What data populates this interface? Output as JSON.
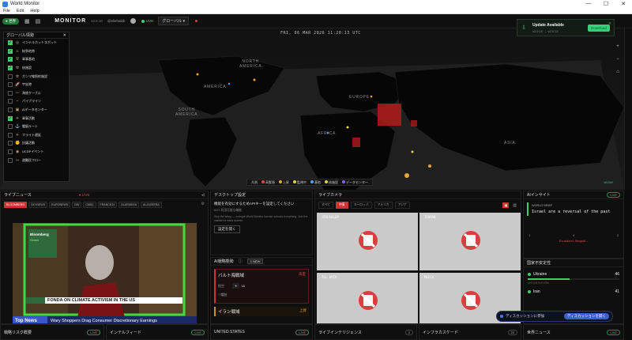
{
  "window": {
    "title": "World Monitor",
    "controls": [
      "—",
      "☐",
      "✕"
    ]
  },
  "menu": [
    "File",
    "Edit",
    "Help"
  ],
  "header": {
    "mode_badge": "● 世界",
    "brand": "MONITOR",
    "version": "v2.5.10",
    "handle": "@eliehabib",
    "live": "LIVE",
    "region": "グローバル ▾"
  },
  "update_toast": {
    "title": "Update Available",
    "subtitle": "v2.5.10 → v2.5.13",
    "button": "Download",
    "close": "✕"
  },
  "map": {
    "date": "FRI, 06 MAR 2026 11:20:13 UTC",
    "labels": {
      "north_america": "NORTH\nAMERICA",
      "america": "AMERICA",
      "south_america": "SOUTH\nAMERICA",
      "europe": "EUROPE",
      "africa": "AFRICA",
      "asia": "ASIA"
    },
    "layers_title": "グローバル情勢",
    "layers_close": "✕",
    "layers": [
      {
        "label": "インテルホットスポット",
        "on": true
      },
      {
        "label": "紛争地帯",
        "on": true
      },
      {
        "label": "軍事基地",
        "on": true
      },
      {
        "label": "核施設",
        "on": true
      },
      {
        "label": "ガンマ線照射施設",
        "on": false
      },
      {
        "label": "宇宙港",
        "on": false
      },
      {
        "label": "海底ケーブル",
        "on": false
      },
      {
        "label": "パイプライン",
        "on": false
      },
      {
        "label": "AIデータセンター",
        "on": false
      },
      {
        "label": "軍事活動",
        "on": true
      },
      {
        "label": "艦艇ルート",
        "on": false
      },
      {
        "label": "フライト遅延",
        "on": false
      },
      {
        "label": "抗議活動",
        "on": false
      },
      {
        "label": "UCDPイベント",
        "on": false
      },
      {
        "label": "避難民フロー",
        "on": false
      }
    ],
    "legend_title": "凡例",
    "legend": [
      {
        "label": "高緊張",
        "color": "#e04444"
      },
      {
        "label": "上昇",
        "color": "#e8a33b"
      },
      {
        "label": "監視中",
        "color": "#e8d23b"
      },
      {
        "label": "基地",
        "color": "#4aa3ff"
      },
      {
        "label": "核施設",
        "color": "#e8d23b"
      },
      {
        "label": "データセンター",
        "color": "#8a5cf0"
      }
    ],
    "controls": [
      "+",
      "−",
      "⌂"
    ],
    "wiki_badge": "WOW!"
  },
  "panels": {
    "live_news": {
      "title": "ライブニュース",
      "live": "● LIVE",
      "channels": [
        "BLOOMBERG",
        "SKYNEWS",
        "EURONEWS",
        "DW",
        "CNBC",
        "FRANCE24",
        "ALARABIYA",
        "ALJAZEERA"
      ],
      "lower_third": "FONDA ON CLIMATE ACTIVISM IN THE US",
      "ticker_left": "Top News",
      "ticker_right": "Wary Shoppers Drag Consumer Discretionary Earnings",
      "bloomberg": "Bloomberg",
      "bloomberg_sub": "Green"
    },
    "desktop": {
      "title": "デスクトップ設定",
      "line1": "機能を有効にするためAPIキーを設定してください",
      "line2": "6/27 利用可能な機能",
      "line3": "Skip the setup — a single World Monitor license unlocks everything. Join the waitlist for early access.",
      "button": "設定を開く"
    },
    "ai_tasks": {
      "title": "AI戦略態勢",
      "badge": "1 NEW",
      "card1_title": "バルト海戦域",
      "card1_status": "高度",
      "card1_row_label": "航空",
      "card1_row_value": "18",
      "card1_trend": "↑ 増加",
      "card2_title": "イラン戦域",
      "card2_status": "上昇"
    },
    "live_cams": {
      "title": "ライブカメラ",
      "tabs": [
        "すべて",
        "中東",
        "ヨーロッパ",
        "アメリカ",
        "アジア"
      ],
      "cams": [
        "JERUSALEM",
        "TEHRAN",
        "TEL AVIV",
        "MECCA"
      ]
    },
    "ai_insight": {
      "title": "AIインサイト",
      "badge": "LIVE",
      "label": "WORLD BRIEF",
      "quote": "Israel are a reversal of the past",
      "left_num": "1",
      "mid_num": "4",
      "right_num": "2",
      "caption": "Ecuadorel, Mogadi..."
    },
    "instability": {
      "title": "国家不安定性",
      "rows": [
        {
          "name": "Ukraine",
          "score": "46",
          "sub": "U:0  C:0  S:0  I:0%"
        },
        {
          "name": "Iran",
          "score": "41",
          "sub": ""
        }
      ]
    },
    "discussion": {
      "join": "ディスカッションに参加",
      "open": "ディスカッションを開く"
    }
  },
  "bottom": [
    {
      "label": "戦略リスク概要",
      "badge": "LIVE"
    },
    {
      "label": "インテルフィード",
      "badge": "LIVE"
    },
    {
      "label": "UNITED STATES",
      "badge": "LIVE"
    },
    {
      "label": "ライブインテリジェンス",
      "badge": "0"
    },
    {
      "label": "インフラカスケード",
      "badge": "20"
    },
    {
      "label": "世界ニュース",
      "badge": "LIVE"
    }
  ]
}
